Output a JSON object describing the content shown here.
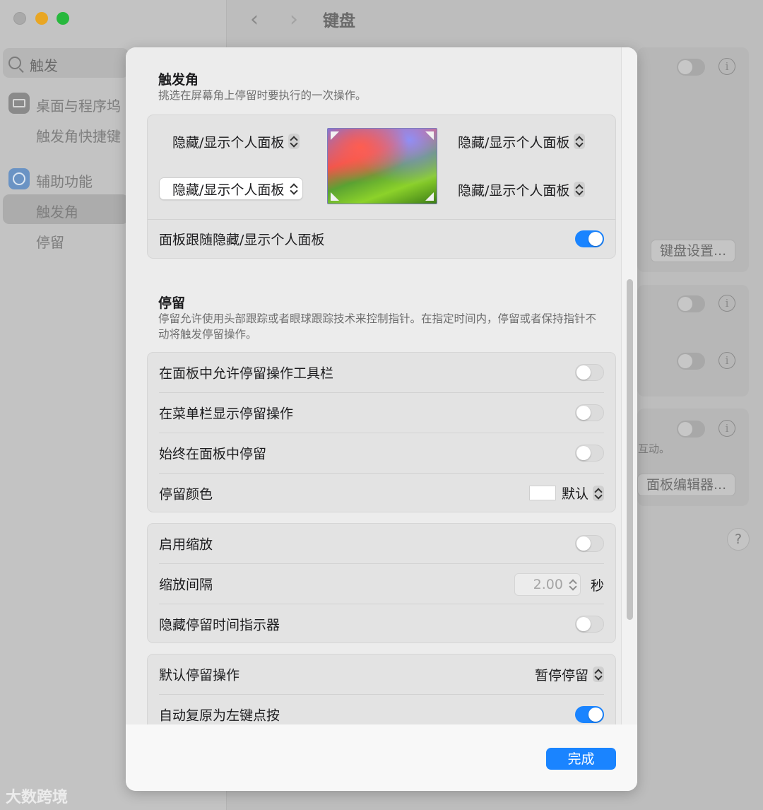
{
  "window": {
    "title": "键盘",
    "sidebar": {
      "search_text": "触发",
      "items": [
        {
          "label": "桌面与程序坞"
        },
        {
          "label": "触发角快捷键"
        },
        {
          "label": "辅助功能"
        },
        {
          "label": "触发角"
        },
        {
          "label": "停留"
        }
      ]
    },
    "main": {
      "keyboard_settings_button": "键盘设置...",
      "panel_editor_button": "面板编辑器...",
      "partial_text": "互动。",
      "help_label": "?",
      "info_label": "i"
    }
  },
  "sheet": {
    "hot_corners": {
      "title": "触发角",
      "description": "挑选在屏幕角上停留时要执行的一次操作。",
      "top_left": "隐藏/显示个人面板",
      "top_right": "隐藏/显示个人面板",
      "bottom_left": "隐藏/显示个人面板",
      "bottom_right": "隐藏/显示个人面板",
      "panel_follow_label": "面板跟随隐藏/显示个人面板",
      "panel_follow_on": true
    },
    "dwell": {
      "title": "停留",
      "description": "停留允许使用头部跟踪或者眼球跟踪技术来控制指针。在指定时间内，停留或者保持指针不动将触发停留操作。",
      "allow_toolbar_label": "在面板中允许停留操作工具栏",
      "show_in_menubar_label": "在菜单栏显示停留操作",
      "always_in_panel_label": "始终在面板中停留",
      "color_label": "停留颜色",
      "color_value": "默认",
      "enable_zoom_label": "启用缩放",
      "zoom_interval_label": "缩放间隔",
      "zoom_interval_value": "2.00",
      "zoom_interval_unit": "秒",
      "hide_timer_label": "隐藏停留时间指示器",
      "default_action_label": "默认停留操作",
      "default_action_value": "暂停停留",
      "auto_revert_label": "自动复原为左键点按",
      "auto_revert_on": true
    },
    "done_button": "完成"
  },
  "watermark": "大数跨境",
  "colors": {
    "accent": "#1a84ff"
  }
}
